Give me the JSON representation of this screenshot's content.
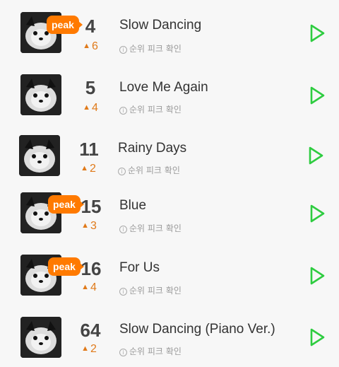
{
  "tracks": [
    {
      "rank": "4",
      "change": "6",
      "title": "Slow Dancing",
      "peak": "peak",
      "peak_check": "순위 피크 확인"
    },
    {
      "rank": "5",
      "change": "4",
      "title": "Love Me Again",
      "peak": "",
      "peak_check": "순위 피크 확인"
    },
    {
      "rank": "11",
      "change": "2",
      "title": "Rainy Days",
      "peak": "",
      "peak_check": "순위 피크 확인"
    },
    {
      "rank": "15",
      "change": "3",
      "title": "Blue",
      "peak": "peak",
      "peak_check": "순위 피크 확인"
    },
    {
      "rank": "16",
      "change": "4",
      "title": "For Us",
      "peak": "peak",
      "peak_check": "순위 피크 확인"
    },
    {
      "rank": "64",
      "change": "2",
      "title": "Slow Dancing (Piano Ver.)",
      "peak": "",
      "peak_check": "순위 피크 확인"
    }
  ],
  "icons": {
    "play": "play-icon",
    "info": "info-icon",
    "rank_up": "triangle-up-icon"
  },
  "colors": {
    "accent": "#ff7a00",
    "play": "#2ecc40",
    "rank_up": "#e07a1a",
    "background": "#f7f7f7"
  }
}
